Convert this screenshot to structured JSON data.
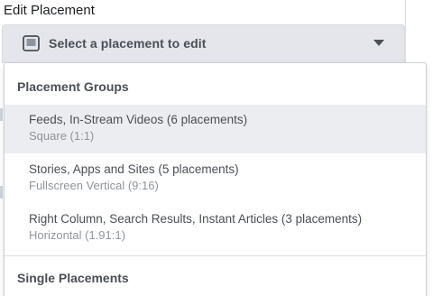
{
  "edit_label": "Edit Placement",
  "select": {
    "placeholder": "Select a placement to edit",
    "icon": "device-screen-icon"
  },
  "dropdown": {
    "groups_header": "Placement Groups",
    "options": [
      {
        "title": "Feeds, In-Stream Videos (6 placements)",
        "subtitle": "Square (1:1)",
        "selected": true
      },
      {
        "title": "Stories, Apps and Sites (5 placements)",
        "subtitle": "Fullscreen Vertical (9:16)",
        "selected": false
      },
      {
        "title": "Right Column, Search Results, Instant Articles (3 placements)",
        "subtitle": "Horizontal (1.91:1)",
        "selected": false
      }
    ],
    "single_header": "Single Placements"
  },
  "colors": {
    "select_bg": "#e4e6eb",
    "selected_option_bg": "#ebedf0",
    "text_primary": "#4b4f56",
    "text_secondary": "#90949c"
  }
}
